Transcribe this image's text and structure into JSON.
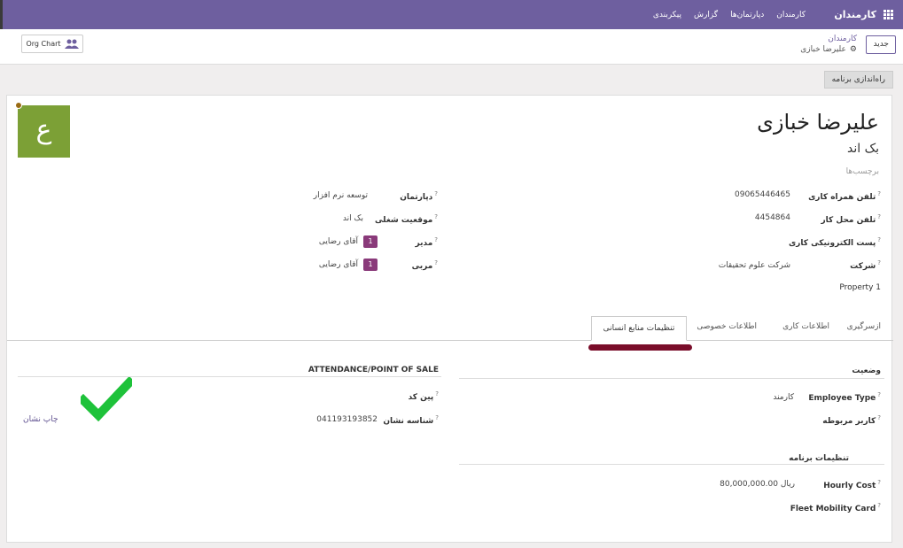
{
  "navbar": {
    "brand": "کارمندان",
    "menu": [
      "کارمندان",
      "دپارتمان‌ها",
      "گزارش",
      "پیکربندی"
    ]
  },
  "control": {
    "new_button": "جدید",
    "breadcrumb_parent": "کارمندان",
    "breadcrumb_current": "علیرضا خبازی",
    "org_chart": "Org Chart",
    "launch_plan": "راه‌اندازی برنامه"
  },
  "employee": {
    "avatar_letter": "ع",
    "name": "علیرضا خبازی",
    "job_title": "بک اند",
    "tags_placeholder": "برچسب‌ها"
  },
  "fields_right": {
    "work_mobile_label": "تلفن همراه کاری",
    "work_mobile": "09065446465",
    "work_phone_label": "تلفن محل کار",
    "work_phone": "4454864",
    "work_email_label": "پست الکترونیکی کاری",
    "company_label": "شرکت",
    "company": "شرکت علوم تحقیقات",
    "property": "Property 1"
  },
  "fields_left": {
    "department_label": "دپارتمان",
    "department": "توسعه نرم افزار",
    "job_position_label": "موقعیت شغلی",
    "job_position": "بک اند",
    "manager_label": "مدیر",
    "manager": "آقای رضایی",
    "manager_badge": "1",
    "coach_label": "مربی",
    "coach": "آقای رضایی",
    "coach_badge": "1"
  },
  "tabs": {
    "resume": "ازسرگیری",
    "work_info": "اطلاعات کاری",
    "private_info": "اطلاعات خصوصی",
    "hr_settings": "تنظیمات منابع انسانی"
  },
  "hr": {
    "status_title": "وضعیت",
    "employee_type_label": "Employee Type",
    "employee_type": "کارمند",
    "related_user_label": "کاربر مربوطه",
    "payroll_title": "تنظیمات برنامه",
    "hourly_cost_label": "Hourly Cost",
    "hourly_cost": "80,000,000.00",
    "currency": "ریال",
    "fleet_card_label": "Fleet Mobility Card",
    "attendance_title": "ATTENDANCE/POINT OF SALE",
    "pin_label": "پین کد",
    "badge_id_label": "شناسه نشان",
    "badge_id": "041193193852",
    "print_badge": "چاپ نشان"
  },
  "colors": {
    "navbar": "#6e5f9f",
    "avatar": "#7ca036",
    "badge": "#8a3a7a",
    "tab_marker": "#7a0d2a",
    "check": "#1ec23a"
  }
}
